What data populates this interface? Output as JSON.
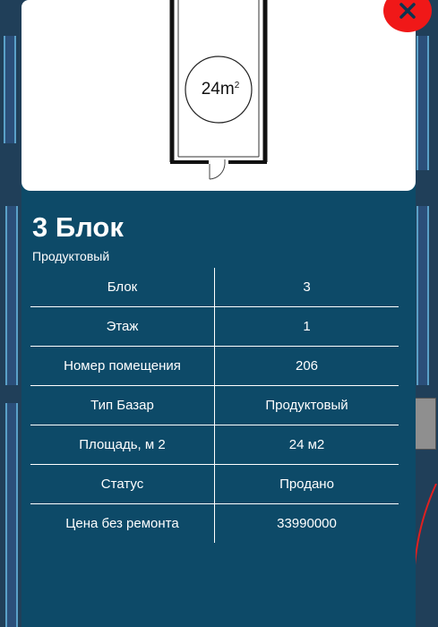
{
  "plan": {
    "area_value": "24m",
    "area_unit_sup": "2"
  },
  "block": {
    "title": "3 Блок",
    "subtitle": "Продуктовый"
  },
  "details": [
    {
      "label": "Блок",
      "value": "3"
    },
    {
      "label": "Этаж",
      "value": "1"
    },
    {
      "label": "Номер помещения",
      "value": "206"
    },
    {
      "label": "Тип Базар",
      "value": "Продуктовый"
    },
    {
      "label": "Площадь, м 2",
      "value": "24 м2"
    },
    {
      "label": "Статус",
      "value": "Продано"
    },
    {
      "label": "Цена без ремонта",
      "value": "33990000"
    }
  ],
  "colors": {
    "modal_bg": "#0d4a68",
    "close_button": "#f01818",
    "text": "#ffffff"
  },
  "icons": {
    "close": "close-icon",
    "door": "door-icon"
  }
}
